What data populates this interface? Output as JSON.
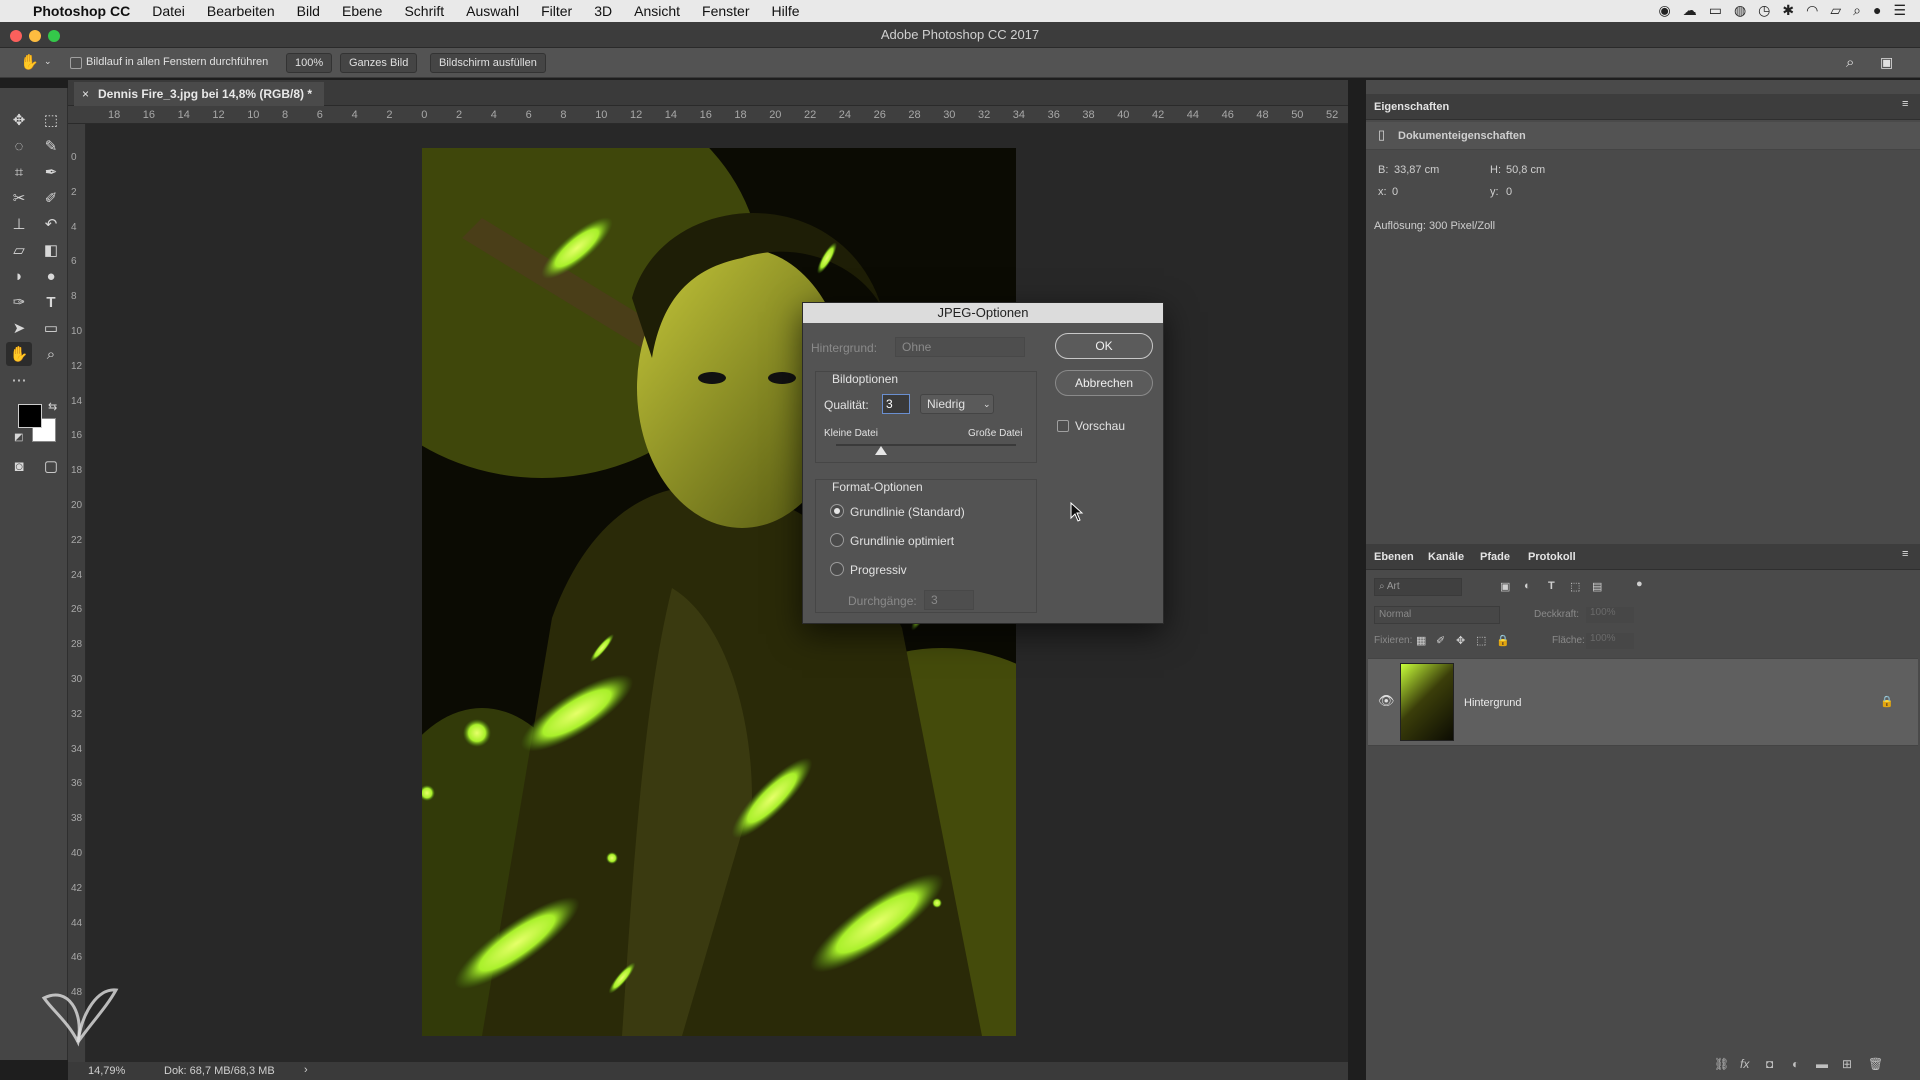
{
  "menubar": {
    "app": "Photoshop CC",
    "items": [
      "Datei",
      "Bearbeiten",
      "Bild",
      "Ebene",
      "Schrift",
      "Auswahl",
      "Filter",
      "3D",
      "Ansicht",
      "Fenster",
      "Hilfe"
    ]
  },
  "window": {
    "title": "Adobe Photoshop CC 2017"
  },
  "options_bar": {
    "scroll_all_label": "Bildlauf in allen Fenstern durchführen",
    "zoom_100": "100%",
    "fit_screen": "Ganzes Bild",
    "fill_screen": "Bildschirm ausfüllen"
  },
  "document": {
    "tab_title": "Dennis Fire_3.jpg bei 14,8% (RGB/8) *",
    "h_ruler": [
      "18",
      "16",
      "14",
      "12",
      "10",
      "8",
      "6",
      "4",
      "2",
      "0",
      "2",
      "4",
      "6",
      "8",
      "10",
      "12",
      "14",
      "16",
      "18",
      "20",
      "22",
      "24",
      "26",
      "28",
      "30",
      "32",
      "34",
      "36",
      "38",
      "40",
      "42",
      "44",
      "46",
      "48",
      "50",
      "52"
    ],
    "v_ruler": [
      "0",
      "2",
      "4",
      "6",
      "8",
      "10",
      "12",
      "14",
      "16",
      "18",
      "20",
      "22",
      "24",
      "26",
      "28",
      "30",
      "32",
      "34",
      "36",
      "38",
      "40",
      "42",
      "44",
      "46",
      "48"
    ]
  },
  "status": {
    "zoom": "14,79%",
    "doc": "Dok: 68,7 MB/68,3 MB"
  },
  "properties": {
    "header": "Eigenschaften",
    "section": "Dokumenteigenschaften",
    "width_label": "B:",
    "width_value": "33,87 cm",
    "height_label": "H:",
    "height_value": "50,8 cm",
    "x_label": "x:",
    "x_value": "0",
    "y_label": "y:",
    "y_value": "0",
    "resolution": "Auflösung: 300 Pixel/Zoll"
  },
  "layers_panel": {
    "tabs": [
      "Ebenen",
      "Kanäle",
      "Pfade",
      "Protokoll"
    ],
    "filter_placeholder": "Art",
    "blend_mode": "Normal",
    "opacity_label": "Deckkraft:",
    "opacity_value": "100%",
    "lock_label": "Fixieren:",
    "fill_label": "Fläche:",
    "fill_value": "100%",
    "layers": [
      {
        "name": "Hintergrund",
        "visible": true,
        "locked": true
      }
    ]
  },
  "jpeg_dialog": {
    "title": "JPEG-Optionen",
    "background_label": "Hintergrund:",
    "background_value": "Ohne",
    "image_options_title": "Bildoptionen",
    "quality_label": "Qualität:",
    "quality_value": "3",
    "quality_level": "Niedrig",
    "quality_fraction": 0.25,
    "small_file": "Kleine Datei",
    "large_file": "Große Datei",
    "format_options_title": "Format-Optionen",
    "formats": [
      "Grundlinie (Standard)",
      "Grundlinie optimiert",
      "Progressiv"
    ],
    "selected_format": 0,
    "passes_label": "Durchgänge:",
    "passes_value": "3",
    "ok": "OK",
    "cancel": "Abbrechen",
    "preview_label": "Vorschau",
    "preview_checked": false
  },
  "colors": {
    "accent_glow": "#c8ff3a",
    "app_bg": "#535353",
    "dialog_bg": "#535353"
  }
}
